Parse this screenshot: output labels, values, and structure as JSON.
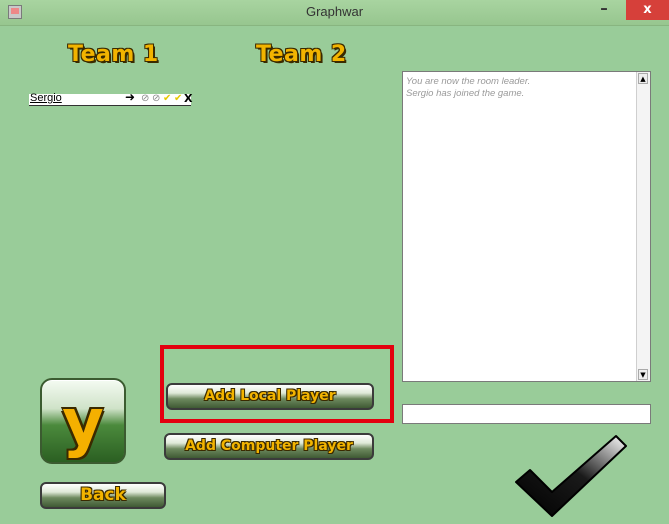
{
  "window": {
    "title": "Graphwar",
    "minimize_label": "–",
    "close_label": "x"
  },
  "teams": {
    "team1_label": "Team 1",
    "team2_label": "Team 2"
  },
  "player": {
    "name": "Sergio",
    "remove_label": "X"
  },
  "chat": {
    "messages": [
      "You are now the room leader.",
      "Sergio has joined the game."
    ],
    "input_value": ""
  },
  "buttons": {
    "y_label": "y",
    "add_local_label": "Add Local Player",
    "add_computer_label": "Add Computer Player",
    "back_label": "Back"
  },
  "colors": {
    "background": "#99cc99",
    "accent_text": "#f2b400",
    "highlight": "#e3000f",
    "close_button": "#d6403a"
  },
  "icons": [
    "java-app-icon",
    "arrow-right-icon",
    "circle-slash-icon",
    "check-icon",
    "ready-checkmark-icon"
  ]
}
